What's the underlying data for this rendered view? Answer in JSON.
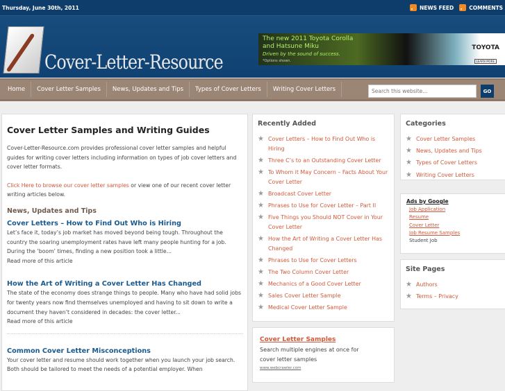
{
  "topbar": {
    "date": "Thursday, June 30th, 2011",
    "links": [
      {
        "label": "NEWS FEED",
        "icon": "rss-icon"
      },
      {
        "label": "COMMENTS",
        "icon": "rss-icon"
      }
    ]
  },
  "header": {
    "logo_text": "Cover-Letter-Resource",
    "ad": {
      "line1": "The new 2011 Toyota Corolla",
      "line2": "and Hatsune Miku",
      "line3": "Driven by the sound of success.",
      "line4": "*Options shown.",
      "brand": "TOYOTA",
      "cta": "LEARN MORE"
    }
  },
  "nav": {
    "items": [
      "Home",
      "Cover Letter Samples",
      "News, Updates and Tips",
      "Types of Cover Letters",
      "Writing Cover Letters"
    ],
    "search_placeholder": "Search this website...",
    "go": "GO"
  },
  "main": {
    "title": "Cover Letter Samples and Writing Guides",
    "intro": "Cover-Letter-Resource.com provides professional cover letter samples and helpful guides for writing cover letters including information on types of job cover letters and cover letter formats.",
    "browse_link": "Click Here to browse our cover letter samples",
    "browse_rest": " or view one of our recent cover letter writing articles below.",
    "section": "News, Updates and Tips",
    "read_more": "Read more of this article",
    "articles": [
      {
        "title": "Cover Letters – How to Find Out Who is Hiring",
        "excerpt": "Let’s face it, today’s job market has moved beyond being tough. Throughout the country the soaring unemployment rates have left many people hunting for a job. During the ‘boom’ times, finding a new position took a little..."
      },
      {
        "title": "How the Art of Writing a Cover Letter Has Changed",
        "excerpt": "The state of the economy does strange things to people. Many who have had solid jobs for twenty years now find themselves unemployed and having to sit down to write a document they haven’t considered in decades: the cover letter..."
      },
      {
        "title": "Common Cover Letter Misconceptions",
        "excerpt": "Your cover letter and resume should work together when you launch your job search. Both should be tailored to meet the needs of a potential employer. When"
      }
    ]
  },
  "recent": {
    "title": "Recently Added",
    "items": [
      "Cover Letters – How to Find Out Who is Hiring",
      "Three C’s to an Outstanding Cover Letter",
      "To Whom it May Concern – Facts About Your Cover Letter",
      "Broadcast Cover Letter",
      "Phrases to Use for Cover Letter – Part II",
      "Five Things you Should NOT Cover in Your Cover Letter",
      "How the Art of Writing a Cover Letter Has Changed",
      "Phrases to Use for Cover Letters",
      "The Two Column Cover Letter",
      "Mechanics of a Good Cover Letter",
      "Sales Cover Letter Sample",
      "Medical Cover Letter Sample"
    ]
  },
  "ad2": {
    "title": "Cover Letter Samples",
    "text": "Search multiple engines at once for cover letter samples",
    "url": "www.webcrawler.com"
  },
  "categories": {
    "title": "Categories",
    "items": [
      "Cover Letter Samples",
      "News, Updates and Tips",
      "Types of Cover Letters",
      "Writing Cover Letters"
    ]
  },
  "google_ads": {
    "title": "Ads by Google",
    "items": [
      "Job Application",
      "Resume",
      "Cover Letter",
      "Job Resume Samples"
    ],
    "plain": "Student Job"
  },
  "site_pages": {
    "title": "Site Pages",
    "items": [
      "Authors",
      "Terms – Privacy"
    ]
  }
}
